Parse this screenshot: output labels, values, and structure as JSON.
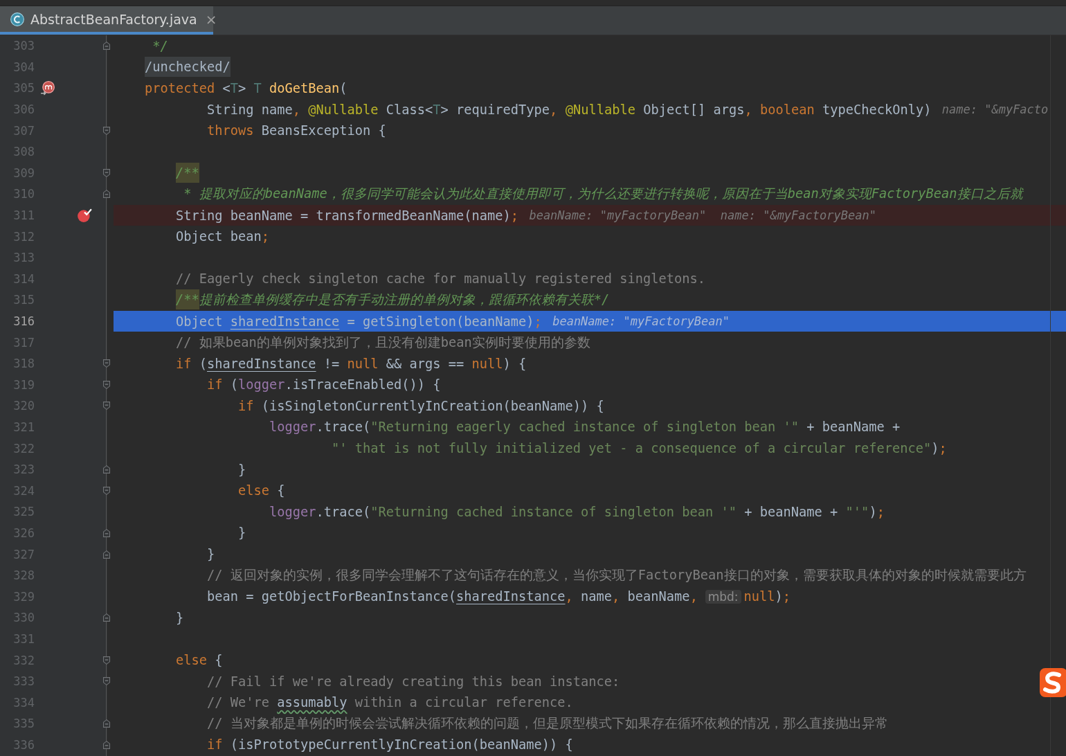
{
  "tab": {
    "title": "AbstractBeanFactory.java",
    "close": "×",
    "selected": true
  },
  "lines": [
    {
      "number": "303",
      "breakpoint": false,
      "method_breakpoint": false,
      "fold_open": false,
      "fold_close": true,
      "selected": false,
      "segments": [
        {
          "kind": "code",
          "tokens": [
            {
              "kind": "doc",
              "text": "     */"
            }
          ]
        }
      ]
    },
    {
      "number": "304",
      "breakpoint": false,
      "method_breakpoint": false,
      "fold_open": false,
      "fold_close": false,
      "selected": false,
      "segments": [
        {
          "kind": "code",
          "tokens": [
            {
              "kind": "folded",
              "text": "    /unchecked/"
            }
          ]
        }
      ]
    },
    {
      "number": "305",
      "breakpoint": false,
      "method_breakpoint": true,
      "fold_open": false,
      "fold_close": false,
      "selected": false,
      "segments": [
        {
          "kind": "code",
          "tokens": [
            {
              "kind": "kw",
              "text": "    protected"
            },
            {
              "kind": "plain",
              "text": " <"
            },
            {
              "kind": "tparam",
              "text": "T"
            },
            {
              "kind": "plain",
              "text": "> "
            },
            {
              "kind": "tparam",
              "text": "T"
            },
            {
              "kind": "fn",
              "text": " doGetBean"
            },
            {
              "kind": "plain",
              "text": "("
            }
          ]
        }
      ]
    },
    {
      "number": "306",
      "breakpoint": false,
      "method_breakpoint": false,
      "fold_open": false,
      "fold_close": false,
      "selected": false,
      "segments": [
        {
          "kind": "code",
          "tokens": [
            {
              "kind": "plain",
              "text": "            String name"
            },
            {
              "kind": "kw",
              "text": ", "
            },
            {
              "kind": "ann",
              "text": "@Nullable"
            },
            {
              "kind": "plain",
              "text": " Class<"
            },
            {
              "kind": "tparam",
              "text": "T"
            },
            {
              "kind": "plain",
              "text": "> requiredType"
            },
            {
              "kind": "kw",
              "text": ", "
            },
            {
              "kind": "ann",
              "text": "@Nullable"
            },
            {
              "kind": "plain",
              "text": " Object[] args"
            },
            {
              "kind": "kw",
              "text": ", boolean"
            },
            {
              "kind": "plain",
              "text": " typeCheckOnly)"
            }
          ]
        },
        {
          "kind": "hint",
          "text": "name: \"&myFacto"
        }
      ]
    },
    {
      "number": "307",
      "breakpoint": false,
      "method_breakpoint": false,
      "fold_open": true,
      "fold_close": false,
      "selected": false,
      "segments": [
        {
          "kind": "code",
          "tokens": [
            {
              "kind": "kw",
              "text": "            throws"
            },
            {
              "kind": "plain",
              "text": " BeansException {"
            }
          ]
        }
      ]
    },
    {
      "number": "308",
      "breakpoint": false,
      "method_breakpoint": false,
      "fold_open": false,
      "fold_close": false,
      "selected": false
    },
    {
      "number": "309",
      "breakpoint": false,
      "method_breakpoint": false,
      "fold_open": true,
      "fold_close": false,
      "selected": false,
      "segments": [
        {
          "kind": "code",
          "tokens": [
            {
              "kind": "marked",
              "text": "        /**"
            }
          ]
        }
      ]
    },
    {
      "number": "310",
      "breakpoint": false,
      "method_breakpoint": false,
      "fold_open": false,
      "fold_close": true,
      "selected": false,
      "segments": [
        {
          "kind": "code",
          "tokens": [
            {
              "kind": "doc",
              "text": "         * 提取对应的beanName，很多同学可能会认为此处直接使用即可，为什么还要进行转换呢，原因在于当bean对象实现FactoryBean接口之后就"
            }
          ]
        }
      ]
    },
    {
      "number": "311",
      "breakpoint": true,
      "method_breakpoint": false,
      "fold_open": false,
      "fold_close": false,
      "selected": false,
      "segments": [
        {
          "kind": "code",
          "tokens": [
            {
              "kind": "plain",
              "text": "        String beanName = transformedBeanName(name)"
            },
            {
              "kind": "kw",
              "text": ";"
            }
          ]
        },
        {
          "kind": "hint",
          "text": "beanName: \"myFactoryBean\"  name: \"&myFactoryBean\""
        }
      ]
    },
    {
      "number": "312",
      "breakpoint": false,
      "method_breakpoint": false,
      "fold_open": false,
      "fold_close": false,
      "selected": false,
      "segments": [
        {
          "kind": "code",
          "tokens": [
            {
              "kind": "plain",
              "text": "        Object bean"
            },
            {
              "kind": "kw",
              "text": ";"
            }
          ]
        }
      ]
    },
    {
      "number": "313",
      "breakpoint": false,
      "method_breakpoint": false,
      "fold_open": false,
      "fold_close": false,
      "selected": false
    },
    {
      "number": "314",
      "breakpoint": false,
      "method_breakpoint": false,
      "fold_open": false,
      "fold_close": false,
      "selected": false,
      "segments": [
        {
          "kind": "code",
          "tokens": [
            {
              "kind": "cmt",
              "text": "        // Eagerly check singleton cache for manually registered singletons."
            }
          ]
        }
      ]
    },
    {
      "number": "315",
      "breakpoint": false,
      "method_breakpoint": false,
      "fold_open": false,
      "fold_close": false,
      "selected": false,
      "segments": [
        {
          "kind": "code",
          "tokens": [
            {
              "kind": "marked",
              "text": "        /**"
            },
            {
              "kind": "doc",
              "text": "提前检查单例缓存中是否有手动注册的单例对象，跟循环依赖有关联*/"
            }
          ]
        }
      ]
    },
    {
      "number": "316",
      "breakpoint": false,
      "method_breakpoint": false,
      "fold_open": false,
      "fold_close": false,
      "selected": true,
      "segments": [
        {
          "kind": "code",
          "tokens": [
            {
              "kind": "plain",
              "text": "        Object "
            },
            {
              "kind": "under",
              "text": "sharedInstance"
            },
            {
              "kind": "plain",
              "text": " = getSingleton(beanName)"
            },
            {
              "kind": "kw",
              "text": ";"
            }
          ]
        },
        {
          "kind": "hint",
          "text": "beanName: \"myFactoryBean\""
        }
      ]
    },
    {
      "number": "317",
      "breakpoint": false,
      "method_breakpoint": false,
      "fold_open": false,
      "fold_close": false,
      "selected": false,
      "segments": [
        {
          "kind": "code",
          "tokens": [
            {
              "kind": "cmt",
              "text": "        // 如果bean的单例对象找到了，且没有创建bean实例时要使用的参数"
            }
          ]
        }
      ]
    },
    {
      "number": "318",
      "breakpoint": false,
      "method_breakpoint": false,
      "fold_open": true,
      "fold_close": false,
      "selected": false,
      "segments": [
        {
          "kind": "code",
          "tokens": [
            {
              "kind": "kw",
              "text": "        if"
            },
            {
              "kind": "plain",
              "text": " ("
            },
            {
              "kind": "under",
              "text": "sharedInstance"
            },
            {
              "kind": "plain",
              "text": " != "
            },
            {
              "kind": "kw",
              "text": "null"
            },
            {
              "kind": "plain",
              "text": " && args == "
            },
            {
              "kind": "kw",
              "text": "null"
            },
            {
              "kind": "plain",
              "text": ") {"
            }
          ]
        }
      ]
    },
    {
      "number": "319",
      "breakpoint": false,
      "method_breakpoint": false,
      "fold_open": true,
      "fold_close": false,
      "selected": false,
      "segments": [
        {
          "kind": "code",
          "tokens": [
            {
              "kind": "kw",
              "text": "            if"
            },
            {
              "kind": "plain",
              "text": " ("
            },
            {
              "kind": "field",
              "text": "logger"
            },
            {
              "kind": "plain",
              "text": ".isTraceEnabled()) {"
            }
          ]
        }
      ]
    },
    {
      "number": "320",
      "breakpoint": false,
      "method_breakpoint": false,
      "fold_open": true,
      "fold_close": false,
      "selected": false,
      "segments": [
        {
          "kind": "code",
          "tokens": [
            {
              "kind": "kw",
              "text": "                if"
            },
            {
              "kind": "plain",
              "text": " (isSingletonCurrentlyInCreation(beanName)) {"
            }
          ]
        }
      ]
    },
    {
      "number": "321",
      "breakpoint": false,
      "method_breakpoint": false,
      "fold_open": false,
      "fold_close": false,
      "selected": false,
      "segments": [
        {
          "kind": "code",
          "tokens": [
            {
              "kind": "field",
              "text": "                    logger"
            },
            {
              "kind": "plain",
              "text": ".trace("
            },
            {
              "kind": "str",
              "text": "\"Returning eagerly cached instance of singleton bean '\""
            },
            {
              "kind": "plain",
              "text": " + beanName +"
            }
          ]
        }
      ]
    },
    {
      "number": "322",
      "breakpoint": false,
      "method_breakpoint": false,
      "fold_open": false,
      "fold_close": false,
      "selected": false,
      "segments": [
        {
          "kind": "code",
          "tokens": [
            {
              "kind": "str",
              "text": "                            \"' that is not fully initialized yet - a consequence of a circular reference\""
            },
            {
              "kind": "plain",
              "text": ")"
            },
            {
              "kind": "kw",
              "text": ";"
            }
          ]
        }
      ]
    },
    {
      "number": "323",
      "breakpoint": false,
      "method_breakpoint": false,
      "fold_open": false,
      "fold_close": true,
      "selected": false,
      "segments": [
        {
          "kind": "code",
          "tokens": [
            {
              "kind": "plain",
              "text": "                }"
            }
          ]
        }
      ]
    },
    {
      "number": "324",
      "breakpoint": false,
      "method_breakpoint": false,
      "fold_open": true,
      "fold_close": false,
      "selected": false,
      "segments": [
        {
          "kind": "code",
          "tokens": [
            {
              "kind": "kw",
              "text": "                else"
            },
            {
              "kind": "plain",
              "text": " {"
            }
          ]
        }
      ]
    },
    {
      "number": "325",
      "breakpoint": false,
      "method_breakpoint": false,
      "fold_open": false,
      "fold_close": false,
      "selected": false,
      "segments": [
        {
          "kind": "code",
          "tokens": [
            {
              "kind": "field",
              "text": "                    logger"
            },
            {
              "kind": "plain",
              "text": ".trace("
            },
            {
              "kind": "str",
              "text": "\"Returning cached instance of singleton bean '\""
            },
            {
              "kind": "plain",
              "text": " + beanName + "
            },
            {
              "kind": "str",
              "text": "\"'\""
            },
            {
              "kind": "plain",
              "text": ")"
            },
            {
              "kind": "kw",
              "text": ";"
            }
          ]
        }
      ]
    },
    {
      "number": "326",
      "breakpoint": false,
      "method_breakpoint": false,
      "fold_open": false,
      "fold_close": true,
      "selected": false,
      "segments": [
        {
          "kind": "code",
          "tokens": [
            {
              "kind": "plain",
              "text": "                }"
            }
          ]
        }
      ]
    },
    {
      "number": "327",
      "breakpoint": false,
      "method_breakpoint": false,
      "fold_open": false,
      "fold_close": true,
      "selected": false,
      "segments": [
        {
          "kind": "code",
          "tokens": [
            {
              "kind": "plain",
              "text": "            }"
            }
          ]
        }
      ]
    },
    {
      "number": "328",
      "breakpoint": false,
      "method_breakpoint": false,
      "fold_open": false,
      "fold_close": false,
      "selected": false,
      "segments": [
        {
          "kind": "code",
          "tokens": [
            {
              "kind": "cmt",
              "text": "            // 返回对象的实例，很多同学会理解不了这句话存在的意义，当你实现了FactoryBean接口的对象，需要获取具体的对象的时候就需要此方"
            }
          ]
        }
      ]
    },
    {
      "number": "329",
      "breakpoint": false,
      "method_breakpoint": false,
      "fold_open": false,
      "fold_close": false,
      "selected": false,
      "segments": [
        {
          "kind": "code",
          "tokens": [
            {
              "kind": "plain",
              "text": "            bean = getObjectForBeanInstance("
            },
            {
              "kind": "under",
              "text": "sharedInstance"
            },
            {
              "kind": "kw",
              "text": ","
            },
            {
              "kind": "plain",
              "text": " name"
            },
            {
              "kind": "kw",
              "text": ","
            },
            {
              "kind": "plain",
              "text": " beanName"
            },
            {
              "kind": "kw",
              "text": ","
            }
          ]
        },
        {
          "kind": "param",
          "text": "mbd:"
        },
        {
          "kind": "code",
          "tokens": [
            {
              "kind": "kw",
              "text": "null"
            },
            {
              "kind": "plain",
              "text": ")"
            },
            {
              "kind": "kw",
              "text": ";"
            }
          ]
        }
      ]
    },
    {
      "number": "330",
      "breakpoint": false,
      "method_breakpoint": false,
      "fold_open": false,
      "fold_close": true,
      "selected": false,
      "segments": [
        {
          "kind": "code",
          "tokens": [
            {
              "kind": "plain",
              "text": "        }"
            }
          ]
        }
      ]
    },
    {
      "number": "331",
      "breakpoint": false,
      "method_breakpoint": false,
      "fold_open": false,
      "fold_close": false,
      "selected": false
    },
    {
      "number": "332",
      "breakpoint": false,
      "method_breakpoint": false,
      "fold_open": true,
      "fold_close": false,
      "selected": false,
      "segments": [
        {
          "kind": "code",
          "tokens": [
            {
              "kind": "kw",
              "text": "        else"
            },
            {
              "kind": "plain",
              "text": " {"
            }
          ]
        }
      ]
    },
    {
      "number": "333",
      "breakpoint": false,
      "method_breakpoint": false,
      "fold_open": true,
      "fold_close": false,
      "selected": false,
      "segments": [
        {
          "kind": "code",
          "tokens": [
            {
              "kind": "cmt",
              "text": "            // Fail if we're already creating this bean instance:"
            }
          ]
        }
      ]
    },
    {
      "number": "334",
      "breakpoint": false,
      "method_breakpoint": false,
      "fold_open": false,
      "fold_close": false,
      "selected": false,
      "segments": [
        {
          "kind": "code",
          "tokens": [
            {
              "kind": "cmt",
              "text": "            // We're "
            },
            {
              "kind": "typo",
              "text": "assumably"
            },
            {
              "kind": "cmt",
              "text": " within a circular reference."
            }
          ]
        }
      ]
    },
    {
      "number": "335",
      "breakpoint": false,
      "method_breakpoint": false,
      "fold_open": false,
      "fold_close": true,
      "selected": false,
      "segments": [
        {
          "kind": "code",
          "tokens": [
            {
              "kind": "cmt",
              "text": "            // 当对象都是单例的时候会尝试解决循环依赖的问题，但是原型模式下如果存在循环依赖的情况，那么直接抛出异常"
            }
          ]
        }
      ]
    },
    {
      "number": "336",
      "breakpoint": false,
      "method_breakpoint": false,
      "fold_open": false,
      "fold_close": true,
      "selected": false,
      "segments": [
        {
          "kind": "code",
          "tokens": [
            {
              "kind": "kw",
              "text": "            if"
            },
            {
              "kind": "plain",
              "text": " (isPrototypeCurrentlyInCreation(beanName)) {"
            }
          ]
        }
      ]
    }
  ]
}
